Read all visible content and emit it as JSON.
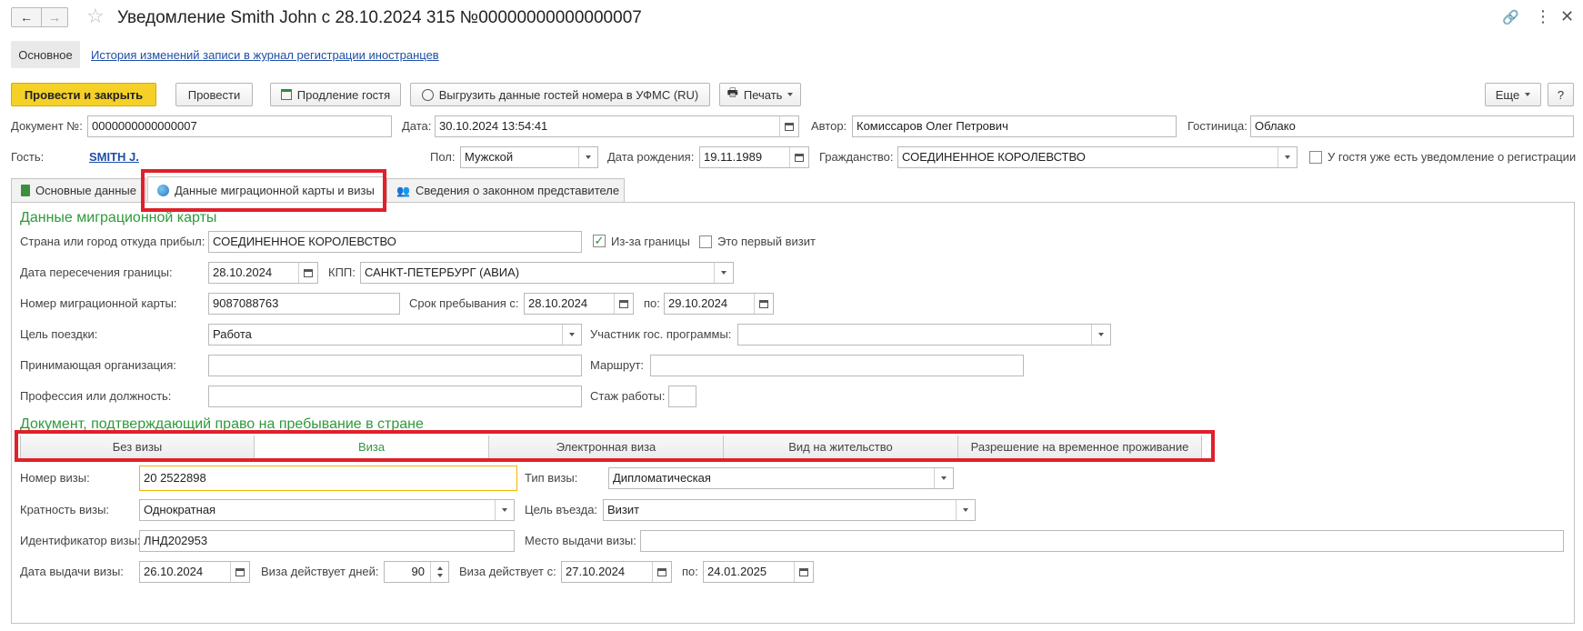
{
  "window": {
    "title": "Уведомление Smith John с 28.10.2024 315 №00000000000000007"
  },
  "nav_tabs": [
    {
      "label": "Основное"
    },
    {
      "label": "История изменений записи в журнал регистрации иностранцев"
    }
  ],
  "toolbar": {
    "post_close": "Провести и закрыть",
    "post": "Провести",
    "extend_guest": "Продление гостя",
    "upload_ufms": "Выгрузить данные гостей номера в УФМС (RU)",
    "print": "Печать",
    "more": "Еще",
    "help": "?"
  },
  "header": {
    "doc_label": "Документ №:",
    "doc_value": "0000000000000007",
    "date_label": "Дата:",
    "date_value": "30.10.2024 13:54:41",
    "author_label": "Автор:",
    "author_value": "Комиссаров Олег Петрович",
    "hotel_label": "Гостиница:",
    "hotel_value": "Облако",
    "guest_label": "Гость:",
    "guest_value": "SMITH J.",
    "sex_label": "Пол:",
    "sex_value": "Мужской",
    "birth_label": "Дата рождения:",
    "birth_value": "19.11.1989",
    "citizenship_label": "Гражданство:",
    "citizenship_value": "СОЕДИНЕННОЕ КОРОЛЕВСТВО",
    "has_notice_label": "У гостя уже есть уведомление о регистрации"
  },
  "content_tabs": [
    {
      "label": "Основные данные"
    },
    {
      "label": "Данные миграционной карты и визы"
    },
    {
      "label": "Сведения о законном представителе"
    }
  ],
  "migration": {
    "section_title": "Данные миграционной карты",
    "from_label": "Страна или город откуда прибыл:",
    "from_value": "СОЕДИНЕННОЕ КОРОЛЕВСТВО",
    "abroad_label": "Из-за границы",
    "first_visit_label": "Это первый визит",
    "cross_date_label": "Дата пересечения границы:",
    "cross_date_value": "28.10.2024",
    "kpp_label": "КПП:",
    "kpp_value": "САНКТ-ПЕТЕРБУРГ (АВИА)",
    "card_no_label": "Номер миграционной карты:",
    "card_no_value": "9087088763",
    "stay_from_label": "Срок пребывания с:",
    "stay_from_value": "28.10.2024",
    "stay_to_label": "по:",
    "stay_to_value": "29.10.2024",
    "purpose_label": "Цель поездки:",
    "purpose_value": "Работа",
    "program_label": "Участник гос. программы:",
    "program_value": "",
    "host_org_label": "Принимающая организация:",
    "host_org_value": "",
    "route_label": "Маршрут:",
    "route_value": "",
    "profession_label": "Профессия или должность:",
    "profession_value": "",
    "experience_label": "Стаж работы:",
    "experience_value": ""
  },
  "stay_doc": {
    "section_title": "Документ, подтверждающий право на пребывание в стране",
    "options": [
      {
        "label": "Без визы"
      },
      {
        "label": "Виза"
      },
      {
        "label": "Электронная виза"
      },
      {
        "label": "Вид на жительство"
      },
      {
        "label": "Разрешение на временное проживание"
      }
    ]
  },
  "visa": {
    "number_label": "Номер визы:",
    "number_value": "20 2522898",
    "type_label": "Тип визы:",
    "type_value": "Дипломатическая",
    "multiplicity_label": "Кратность визы:",
    "multiplicity_value": "Однократная",
    "entry_purpose_label": "Цель въезда:",
    "entry_purpose_value": "Визит",
    "id_label": "Идентификатор визы:",
    "id_value": "ЛНД202953",
    "place_label": "Место выдачи визы:",
    "place_value": "",
    "issue_date_label": "Дата выдачи визы:",
    "issue_date_value": "26.10.2024",
    "valid_days_label": "Виза действует дней:",
    "valid_days_value": "90",
    "valid_from_label": "Виза действует с:",
    "valid_from_value": "27.10.2024",
    "valid_to_label": "по:",
    "valid_to_value": "24.01.2025"
  },
  "colors": {
    "accent_yellow": "#f5d128",
    "section_green": "#2e9a3a",
    "highlight_red": "#e0202a",
    "link_blue": "#1f4fa8"
  }
}
